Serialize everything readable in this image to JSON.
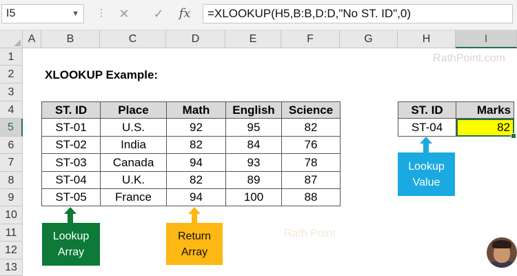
{
  "formula_bar": {
    "name_box": "I5",
    "dots": "⋮",
    "cancel_icon": "✕",
    "enter_icon": "✓",
    "fx_label": "fx",
    "formula": "=XLOOKUP(H5,B:B,D:D,\"No ST. ID\",0)"
  },
  "columns": [
    "A",
    "B",
    "C",
    "D",
    "E",
    "F",
    "G",
    "H",
    "I"
  ],
  "rows": [
    "1",
    "2",
    "3",
    "4",
    "5",
    "6",
    "7",
    "8",
    "9",
    "10",
    "11",
    "12",
    "13"
  ],
  "title": "XLOOKUP Example:",
  "table": {
    "headers": [
      "ST. ID",
      "Place",
      "Math",
      "English",
      "Science"
    ],
    "rows": [
      [
        "ST-01",
        "U.S.",
        "92",
        "95",
        "82"
      ],
      [
        "ST-02",
        "India",
        "82",
        "84",
        "76"
      ],
      [
        "ST-03",
        "Canada",
        "94",
        "93",
        "78"
      ],
      [
        "ST-04",
        "U.K.",
        "82",
        "89",
        "87"
      ],
      [
        "ST-05",
        "France",
        "94",
        "100",
        "88"
      ]
    ]
  },
  "lookup_table": {
    "headers": [
      "ST. ID",
      "Marks"
    ],
    "lookup_value": "ST-04",
    "result": "82"
  },
  "callouts": {
    "lookup_array": [
      "Lookup",
      "Array"
    ],
    "return_array": [
      "Return",
      "Array"
    ],
    "lookup_value": [
      "Lookup",
      "Value"
    ]
  },
  "watermarks": {
    "top": "RathPoint.com",
    "center": "Rath Point"
  },
  "colors": {
    "green": "#0d7a37",
    "orange": "#fdb813",
    "blue": "#1aa9e0",
    "yellow": "#ffff00",
    "excel_green": "#217346"
  }
}
